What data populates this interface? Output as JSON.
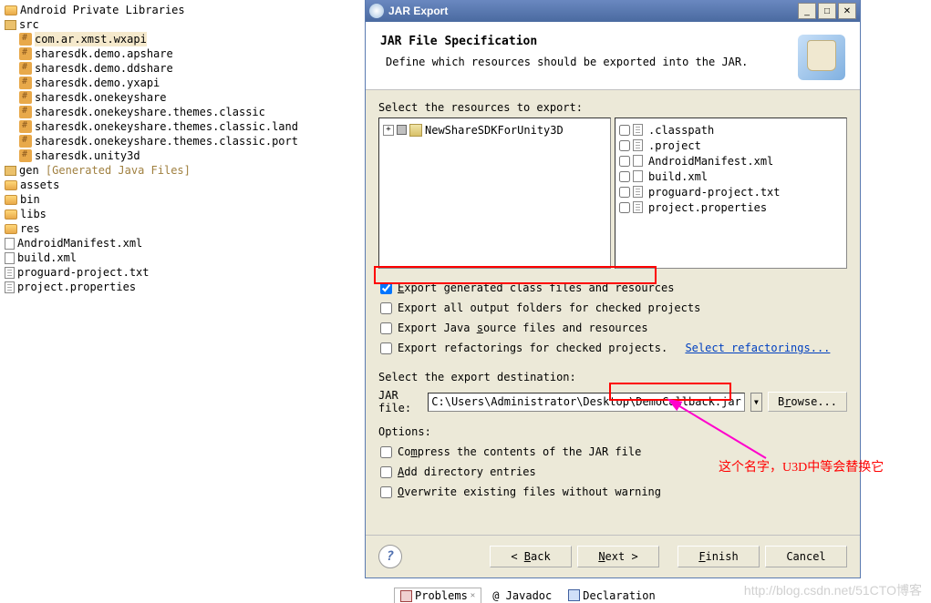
{
  "tree": {
    "root": "Android Private Libraries",
    "src": "src",
    "packages": [
      "com.ar.xmst.wxapi",
      "sharesdk.demo.apshare",
      "sharesdk.demo.ddshare",
      "sharesdk.demo.yxapi",
      "sharesdk.onekeyshare",
      "sharesdk.onekeyshare.themes.classic",
      "sharesdk.onekeyshare.themes.classic.land",
      "sharesdk.onekeyshare.themes.classic.port",
      "sharesdk.unity3d"
    ],
    "gen": "gen",
    "gen_suffix": "[Generated Java Files]",
    "folders": [
      "assets",
      "bin",
      "libs",
      "res"
    ],
    "files": [
      "AndroidManifest.xml",
      "build.xml",
      "proguard-project.txt",
      "project.properties"
    ]
  },
  "dialog": {
    "title": "JAR Export",
    "header_title": "JAR File Specification",
    "header_desc": "Define which resources should be exported into the JAR.",
    "select_resources": "Select the resources to export:",
    "left_tree_item": "NewShareSDKForUnity3D",
    "right_files": [
      ".classpath",
      ".project",
      "AndroidManifest.xml",
      "build.xml",
      "proguard-project.txt",
      "project.properties"
    ],
    "opt_export_class": "Export generated class files and resources",
    "opt_export_output": "Export all output folders for checked projects",
    "opt_export_java": "Export Java source files and resources",
    "opt_export_refactor": "Export refactorings for checked projects.",
    "select_refactorings": "Select refactorings...",
    "select_dest": "Select the export destination:",
    "jar_file": "JAR file:",
    "jar_path_pre": "C:\\Users\\Administrator\\Desktop\\",
    "jar_path_name": "DemoCallback.jar",
    "browse": "Browse...",
    "options": "Options:",
    "opt_compress": "Compress the contents of the JAR file",
    "opt_add_dir": "Add directory entries",
    "opt_overwrite": "Overwrite existing files without warning",
    "back": "< Back",
    "next": "Next >",
    "finish": "Finish",
    "cancel": "Cancel"
  },
  "annotation": "这个名字，U3D中等会替换它",
  "watermark": "http://blog.csdn.net/51CTO博客",
  "bottom_tabs": {
    "problems": "Problems",
    "javadoc": "@ Javadoc",
    "declaration": "Declaration"
  }
}
